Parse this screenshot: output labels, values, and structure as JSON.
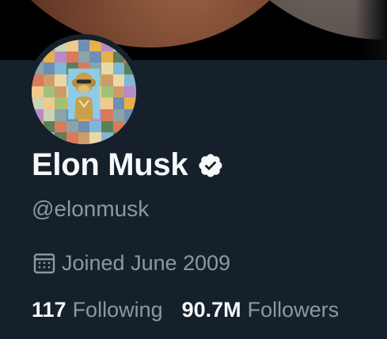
{
  "profile": {
    "name": "Elon Musk",
    "handle": "@elonmusk",
    "joined": "Joined June 2009",
    "verified_icon": "verified-badge-icon",
    "calendar_icon": "calendar-icon"
  },
  "stats": {
    "following_count": "117",
    "following_label": "Following",
    "followers_count": "90.7M",
    "followers_label": "Followers"
  },
  "colors": {
    "background": "#15202b",
    "primary_text": "#f7f9f9",
    "secondary_text": "#8b98a5"
  }
}
